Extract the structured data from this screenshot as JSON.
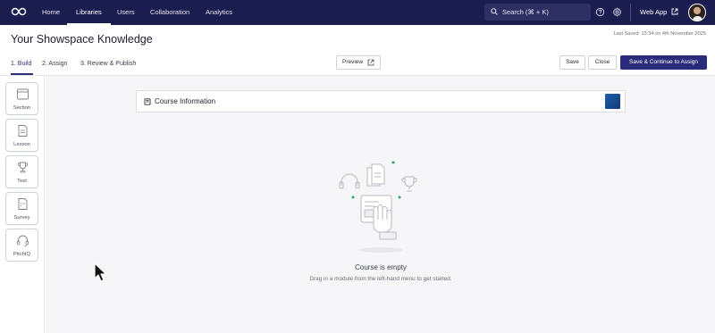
{
  "nav": {
    "items": [
      {
        "label": "Home"
      },
      {
        "label": "Libraries"
      },
      {
        "label": "Users"
      },
      {
        "label": "Collaboration"
      },
      {
        "label": "Analytics"
      }
    ],
    "active": "Libraries",
    "search_label": "Search (⌘ + K)",
    "web_app_label": "Web App",
    "icons": [
      "logo-icon",
      "search-icon",
      "help-icon",
      "gear-icon",
      "external-link-icon",
      "avatar"
    ]
  },
  "header": {
    "title": "Your Showspace Knowledge",
    "last_saved": "Last Saved: 15:34 on 4th November 2025"
  },
  "tabs": [
    {
      "label": "1. Build"
    },
    {
      "label": "2. Assign"
    },
    {
      "label": "3. Review & Publish"
    }
  ],
  "toolbar": {
    "preview_label": "Preview",
    "save_label": "Save",
    "close_label": "Close",
    "save_continue_label": "Save & Continue to Assign"
  },
  "modules": [
    {
      "label": "Section",
      "icon": "section-icon"
    },
    {
      "label": "Lesson",
      "icon": "lesson-icon"
    },
    {
      "label": "Test",
      "icon": "trophy-icon"
    },
    {
      "label": "Survey",
      "icon": "survey-icon"
    },
    {
      "label": "PitchIQ",
      "icon": "headset-icon"
    }
  ],
  "course": {
    "card_title": "Course Information",
    "empty_title": "Course is empty",
    "empty_subtitle": "Drag in a module from the left-hand menu to get started."
  },
  "colors": {
    "nav_bg": "#1c1d4f",
    "primary": "#2a2b7a",
    "canvas_bg": "#f6f6f8",
    "accent_green": "#3aa36a"
  }
}
